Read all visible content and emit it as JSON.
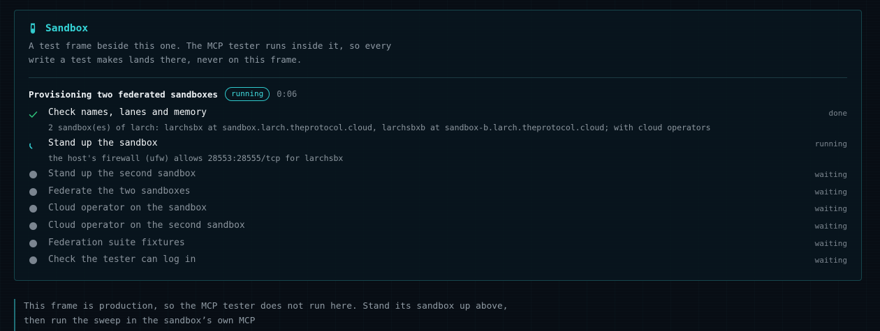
{
  "panel": {
    "title": "Sandbox",
    "icon": "flask-icon",
    "description": "A test frame beside this one. The MCP tester runs inside it, so every write a test makes lands there, never on this frame."
  },
  "provisioning": {
    "title": "Provisioning two federated sandboxes",
    "badge": "running",
    "elapsed": "0:06"
  },
  "steps": [
    {
      "label": "Check names, lanes and memory",
      "status": "done",
      "detail": "2 sandbox(es) of larch: larchsbx at sandbox.larch.theprotocol.cloud, larchsbxb at sandbox-b.larch.theprotocol.cloud; with cloud operators"
    },
    {
      "label": "Stand up the sandbox",
      "status": "running",
      "detail": "the host's firewall (ufw) allows 28553:28555/tcp for larchsbx"
    },
    {
      "label": "Stand up the second sandbox",
      "status": "waiting"
    },
    {
      "label": "Federate the two sandboxes",
      "status": "waiting"
    },
    {
      "label": "Cloud operator on the sandbox",
      "status": "waiting"
    },
    {
      "label": "Cloud operator on the second sandbox",
      "status": "waiting"
    },
    {
      "label": "Federation suite fixtures",
      "status": "waiting"
    },
    {
      "label": "Check the tester can log in",
      "status": "waiting"
    }
  ],
  "note": {
    "text": "This frame is production, so the MCP tester does not run here. Stand its sandbox up above, then run the sweep in the sandbox’s own MCP"
  },
  "colors": {
    "accent": "#35d3d6",
    "done": "#2fc27a",
    "waiting": "#7b8590"
  }
}
